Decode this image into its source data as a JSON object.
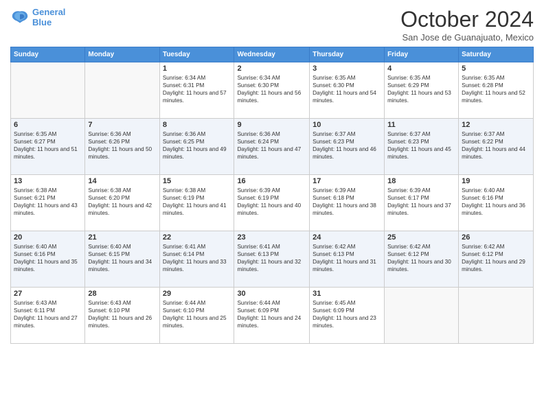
{
  "header": {
    "title": "October 2024",
    "location": "San Jose de Guanajuato, Mexico",
    "logo_line1": "General",
    "logo_line2": "Blue"
  },
  "days_of_week": [
    "Sunday",
    "Monday",
    "Tuesday",
    "Wednesday",
    "Thursday",
    "Friday",
    "Saturday"
  ],
  "weeks": [
    [
      {
        "day": "",
        "info": ""
      },
      {
        "day": "",
        "info": ""
      },
      {
        "day": "1",
        "info": "Sunrise: 6:34 AM\nSunset: 6:31 PM\nDaylight: 11 hours and 57 minutes."
      },
      {
        "day": "2",
        "info": "Sunrise: 6:34 AM\nSunset: 6:30 PM\nDaylight: 11 hours and 56 minutes."
      },
      {
        "day": "3",
        "info": "Sunrise: 6:35 AM\nSunset: 6:30 PM\nDaylight: 11 hours and 54 minutes."
      },
      {
        "day": "4",
        "info": "Sunrise: 6:35 AM\nSunset: 6:29 PM\nDaylight: 11 hours and 53 minutes."
      },
      {
        "day": "5",
        "info": "Sunrise: 6:35 AM\nSunset: 6:28 PM\nDaylight: 11 hours and 52 minutes."
      }
    ],
    [
      {
        "day": "6",
        "info": "Sunrise: 6:35 AM\nSunset: 6:27 PM\nDaylight: 11 hours and 51 minutes."
      },
      {
        "day": "7",
        "info": "Sunrise: 6:36 AM\nSunset: 6:26 PM\nDaylight: 11 hours and 50 minutes."
      },
      {
        "day": "8",
        "info": "Sunrise: 6:36 AM\nSunset: 6:25 PM\nDaylight: 11 hours and 49 minutes."
      },
      {
        "day": "9",
        "info": "Sunrise: 6:36 AM\nSunset: 6:24 PM\nDaylight: 11 hours and 47 minutes."
      },
      {
        "day": "10",
        "info": "Sunrise: 6:37 AM\nSunset: 6:23 PM\nDaylight: 11 hours and 46 minutes."
      },
      {
        "day": "11",
        "info": "Sunrise: 6:37 AM\nSunset: 6:23 PM\nDaylight: 11 hours and 45 minutes."
      },
      {
        "day": "12",
        "info": "Sunrise: 6:37 AM\nSunset: 6:22 PM\nDaylight: 11 hours and 44 minutes."
      }
    ],
    [
      {
        "day": "13",
        "info": "Sunrise: 6:38 AM\nSunset: 6:21 PM\nDaylight: 11 hours and 43 minutes."
      },
      {
        "day": "14",
        "info": "Sunrise: 6:38 AM\nSunset: 6:20 PM\nDaylight: 11 hours and 42 minutes."
      },
      {
        "day": "15",
        "info": "Sunrise: 6:38 AM\nSunset: 6:19 PM\nDaylight: 11 hours and 41 minutes."
      },
      {
        "day": "16",
        "info": "Sunrise: 6:39 AM\nSunset: 6:19 PM\nDaylight: 11 hours and 40 minutes."
      },
      {
        "day": "17",
        "info": "Sunrise: 6:39 AM\nSunset: 6:18 PM\nDaylight: 11 hours and 38 minutes."
      },
      {
        "day": "18",
        "info": "Sunrise: 6:39 AM\nSunset: 6:17 PM\nDaylight: 11 hours and 37 minutes."
      },
      {
        "day": "19",
        "info": "Sunrise: 6:40 AM\nSunset: 6:16 PM\nDaylight: 11 hours and 36 minutes."
      }
    ],
    [
      {
        "day": "20",
        "info": "Sunrise: 6:40 AM\nSunset: 6:16 PM\nDaylight: 11 hours and 35 minutes."
      },
      {
        "day": "21",
        "info": "Sunrise: 6:40 AM\nSunset: 6:15 PM\nDaylight: 11 hours and 34 minutes."
      },
      {
        "day": "22",
        "info": "Sunrise: 6:41 AM\nSunset: 6:14 PM\nDaylight: 11 hours and 33 minutes."
      },
      {
        "day": "23",
        "info": "Sunrise: 6:41 AM\nSunset: 6:13 PM\nDaylight: 11 hours and 32 minutes."
      },
      {
        "day": "24",
        "info": "Sunrise: 6:42 AM\nSunset: 6:13 PM\nDaylight: 11 hours and 31 minutes."
      },
      {
        "day": "25",
        "info": "Sunrise: 6:42 AM\nSunset: 6:12 PM\nDaylight: 11 hours and 30 minutes."
      },
      {
        "day": "26",
        "info": "Sunrise: 6:42 AM\nSunset: 6:12 PM\nDaylight: 11 hours and 29 minutes."
      }
    ],
    [
      {
        "day": "27",
        "info": "Sunrise: 6:43 AM\nSunset: 6:11 PM\nDaylight: 11 hours and 27 minutes."
      },
      {
        "day": "28",
        "info": "Sunrise: 6:43 AM\nSunset: 6:10 PM\nDaylight: 11 hours and 26 minutes."
      },
      {
        "day": "29",
        "info": "Sunrise: 6:44 AM\nSunset: 6:10 PM\nDaylight: 11 hours and 25 minutes."
      },
      {
        "day": "30",
        "info": "Sunrise: 6:44 AM\nSunset: 6:09 PM\nDaylight: 11 hours and 24 minutes."
      },
      {
        "day": "31",
        "info": "Sunrise: 6:45 AM\nSunset: 6:09 PM\nDaylight: 11 hours and 23 minutes."
      },
      {
        "day": "",
        "info": ""
      },
      {
        "day": "",
        "info": ""
      }
    ]
  ]
}
